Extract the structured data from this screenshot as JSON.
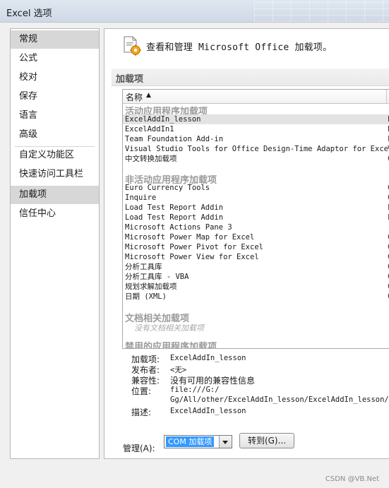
{
  "window": {
    "title": "Excel 选项"
  },
  "nav": {
    "items": [
      "常规",
      "公式",
      "校对",
      "保存",
      "语言",
      "高级",
      "自定义功能区",
      "快速访问工具栏",
      "加载项",
      "信任中心"
    ],
    "selected_label": "加载项",
    "hovered_label": "常规"
  },
  "header": {
    "text": "查看和管理 Microsoft Office 加载项。",
    "icon": "addins-gear-icon"
  },
  "section": {
    "title": "加载项"
  },
  "list": {
    "column_name": "名称",
    "sort_glyph": "▲",
    "groups": [
      {
        "title": "活动应用程序加载项",
        "rows": [
          {
            "name": "ExcelAddIn_lesson",
            "trail": "E"
          },
          {
            "name": "ExcelAddIn1",
            "trail": "E"
          },
          {
            "name": "Team Foundation Add-in",
            "trail": "F"
          },
          {
            "name": "Visual Studio Tools for Office Design-Time Adaptor for Excel",
            "trail": "V"
          },
          {
            "name": "中文转换加载项",
            "trail": "C"
          }
        ]
      },
      {
        "title": "非活动应用程序加载项",
        "rows": [
          {
            "name": "Euro Currency Tools",
            "trail": "C"
          },
          {
            "name": "Inquire",
            "trail": "C"
          },
          {
            "name": "Load Test Report Addin",
            "trail": "F"
          },
          {
            "name": "Load Test Report Addin",
            "trail": "F"
          },
          {
            "name": "Microsoft Actions Pane 3",
            "trail": ""
          },
          {
            "name": "Microsoft Power Map for Excel",
            "trail": "C"
          },
          {
            "name": "Microsoft Power Pivot for Excel",
            "trail": "C"
          },
          {
            "name": "Microsoft Power View for Excel",
            "trail": "C"
          },
          {
            "name": "分析工具库",
            "trail": "C"
          },
          {
            "name": "分析工具库 - VBA",
            "trail": "C"
          },
          {
            "name": "规划求解加载项",
            "trail": "C"
          },
          {
            "name": "日期 (XML)",
            "trail": "C"
          }
        ]
      },
      {
        "title": "文档相关加载项",
        "empty": "没有文档相关加载项"
      },
      {
        "title": "禁用的应用程序加载项"
      }
    ],
    "selected_row": "ExcelAddIn_lesson"
  },
  "details": {
    "addin_label": "加载项:",
    "addin_value": "ExcelAddIn_lesson",
    "publisher_label": "发布者:",
    "publisher_value": "<无>",
    "compat_label": "兼容性:",
    "compat_value": "没有可用的兼容性信息",
    "location_label": "位置:",
    "location_line1": "file:///G:/",
    "location_line2": "Gg/All/other/ExcelAddIn_lesson/ExcelAddIn_lesson/bin",
    "desc_label": "描述:",
    "desc_value": "ExcelAddIn_lesson"
  },
  "manage": {
    "label": "管理(A):",
    "select_value": "COM 加载项",
    "go_button": "转到(G)..."
  },
  "watermark": "CSDN @VB.Net",
  "colors": {
    "selection_blue": "#3399ff",
    "nav_selected": "#d7d7d7",
    "group_title": "#9b9b9b"
  }
}
